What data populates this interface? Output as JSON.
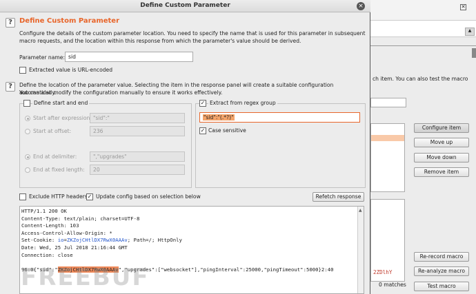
{
  "dialog": {
    "title": "Define Custom Parameter",
    "section_title": "Define Custom Parameter",
    "intro_line1": "Configure the details of the custom parameter location. You need to specify the name that is used for this parameter in subsequent",
    "intro_line2": "macro requests, and the location within this response from which the parameter's value should be derived.",
    "param_name_label": "Parameter name:",
    "param_name_value": "sid",
    "url_encoded_label": "Extracted value is URL-encoded",
    "location_line1": "Define the location of the parameter value. Selecting the item in the response panel will create a suitable configuration automatically.",
    "location_line2": "You can also modify the configuration manually to ensure it works effectively."
  },
  "start_end": {
    "checkbox_label": "Define start and end",
    "start_after_label": "Start after expression:",
    "start_after_value": "\"sid\":\"",
    "start_offset_label": "Start at offset:",
    "start_offset_value": "236",
    "end_delim_label": "End at delimiter:",
    "end_delim_value": "\",\"upgrades\"",
    "end_fixed_label": "End at fixed length:",
    "end_fixed_value": "20"
  },
  "regex": {
    "checkbox_label": "Extract from regex group",
    "value": "\"sid\":\"(.*?)\"",
    "case_label": "Case sensitive"
  },
  "options": {
    "exclude_headers_label": "Exclude HTTP headers",
    "update_config_label": "Update config based on selection below",
    "refetch_label": "Refetch response"
  },
  "response": {
    "lines": [
      "HTTP/1.1 200 OK",
      "Content-Type: text/plain; charset=UTF-8",
      "Content-Length: 103",
      "Access-Control-Allow-Origin: *"
    ],
    "cookie_prefix": "Set-Cookie: ",
    "cookie_key": "io",
    "cookie_eq": "=",
    "cookie_value": "ZKZojCHtlDX7RwX0AAAv",
    "cookie_suffix": "; Path=/; HttpOnly",
    "date_line": "Date: Wed, 25 Jul 2018 21:16:44 GMT",
    "connection_line": "Connection: close",
    "body_prefix": "96:0{\"sid\":\"",
    "body_sid": "ZKZojCHtlDX7RwX0AAAv",
    "body_suffix": "\",\"upgrades\":[\"websocket\"],\"pingInterval\":25000,\"pingTimeout\":5000}2:40"
  },
  "background": {
    "text_fragment_1": "ch item. You can also test the macro",
    "text_fragment_2": "2ZDlhY",
    "matches": "0 matches",
    "buttons": {
      "configure": "Configure item",
      "move_up": "Move up",
      "move_down": "Move down",
      "remove": "Remove item",
      "rerecord": "Re-record macro",
      "reanalyze": "Re-analyze macro",
      "test": "Test macro"
    }
  },
  "watermark": "FREEBUF"
}
